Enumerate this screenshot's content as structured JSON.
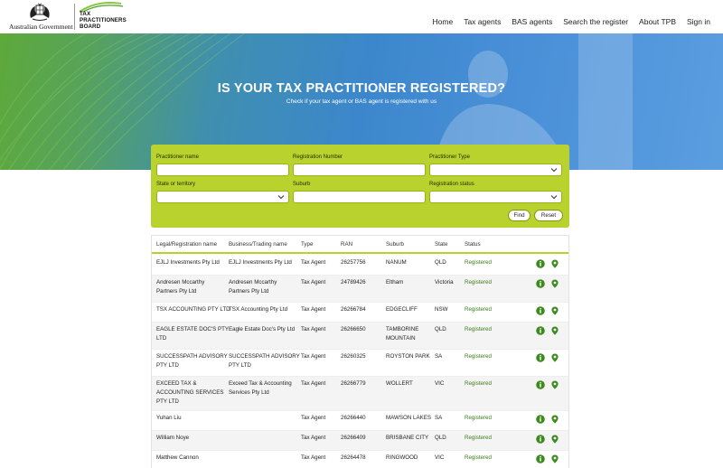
{
  "header": {
    "gov_logo_text": "Australian Government",
    "tpb_logo_lines": [
      "TAX",
      "PRACTITIONERS",
      "BOARD"
    ],
    "nav": [
      "Home",
      "Tax agents",
      "BAS agents",
      "Search the register",
      "About TPB",
      "Sign in"
    ]
  },
  "hero": {
    "title": "IS YOUR TAX PRACTITIONER REGISTERED?",
    "subtitle": "Check if your tax agent or BAS agent is registered with us"
  },
  "search": {
    "practitioner_name_label": "Practitioner name",
    "practitioner_name_value": "",
    "registration_number_label": "Registration Number",
    "registration_number_value": "",
    "practitioner_type_label": "Practitioner Type",
    "practitioner_type_value": "",
    "state_label": "State or territory",
    "state_value": "",
    "suburb_label": "Suburb",
    "suburb_value": "",
    "registration_status_label": "Registration status",
    "registration_status_value": "",
    "find_label": "Find",
    "reset_label": "Reset"
  },
  "table": {
    "columns": [
      "Legal/Registration name",
      "Business/Trading name",
      "Type",
      "RAN",
      "Suburb",
      "State",
      "Status"
    ],
    "rows": [
      {
        "legal": [
          "EJLJ Investments Pty Ltd"
        ],
        "trading": [
          "EJLJ Investments Pty Ltd"
        ],
        "type": "Tax Agent",
        "ran": "26257756",
        "suburb": [
          "NANUM"
        ],
        "state": "QLD",
        "status": "Registered"
      },
      {
        "legal": [
          "Andresen Mccarthy",
          "Partners Pty Ltd"
        ],
        "trading": [
          "Andresen Mccarthy",
          "Partners Pty Ltd"
        ],
        "type": "Tax Agent",
        "ran": "24789426",
        "suburb": [
          "Eltham"
        ],
        "state": "Victoria",
        "status": "Registered"
      },
      {
        "legal": [
          "TSX ACCOUNTING PTY LTD"
        ],
        "trading": [
          "TSX Accounting Pty Ltd"
        ],
        "type": "Tax Agent",
        "ran": "26266784",
        "suburb": [
          "EDGECLIFF"
        ],
        "state": "NSW",
        "status": "Registered"
      },
      {
        "legal": [
          "EAGLE ESTATE DOC'S PTY",
          "LTD"
        ],
        "trading": [
          "Eagle Estate Doc's Pty Ltd"
        ],
        "type": "Tax Agent",
        "ran": "26266650",
        "suburb": [
          "TAMBORINE",
          "MOUNTAIN"
        ],
        "state": "QLD",
        "status": "Registered"
      },
      {
        "legal": [
          "SUCCESSPATH ADVISORY",
          "PTY LTD"
        ],
        "trading": [
          "SUCCESSPATH ADVISORY",
          "PTY LTD"
        ],
        "type": "Tax Agent",
        "ran": "26260325",
        "suburb": [
          "ROYSTON PARK"
        ],
        "state": "SA",
        "status": "Registered"
      },
      {
        "legal": [
          "EXCEED TAX &",
          "ACCOUNTING SERVICES",
          "PTY LTD"
        ],
        "trading": [
          "Exceed Tax & Accounting",
          "Services Pty Ltd"
        ],
        "type": "Tax Agent",
        "ran": "26266779",
        "suburb": [
          "WOLLERT"
        ],
        "state": "VIC",
        "status": "Registered"
      },
      {
        "legal": [
          "Yuhan Liu"
        ],
        "trading": [],
        "type": "Tax Agent",
        "ran": "26266440",
        "suburb": [
          "MAWSON LAKES"
        ],
        "state": "SA",
        "status": "Registered"
      },
      {
        "legal": [
          "William Noye"
        ],
        "trading": [],
        "type": "Tax Agent",
        "ran": "26266409",
        "suburb": [
          "BRISBANE CITY"
        ],
        "state": "QLD",
        "status": "Registered"
      },
      {
        "legal": [
          "Matthew Cannon"
        ],
        "trading": [],
        "type": "Tax Agent",
        "ran": "26264478",
        "suburb": [
          "RINGWOOD"
        ],
        "state": "VIC",
        "status": "Registered"
      }
    ]
  },
  "colors": {
    "accent_green": "#b9d22e",
    "status_green": "#3a7d1a",
    "icon_green": "#3d8a1e"
  },
  "icons": [
    "info-icon",
    "location-pin-icon",
    "chevron-down-icon"
  ]
}
